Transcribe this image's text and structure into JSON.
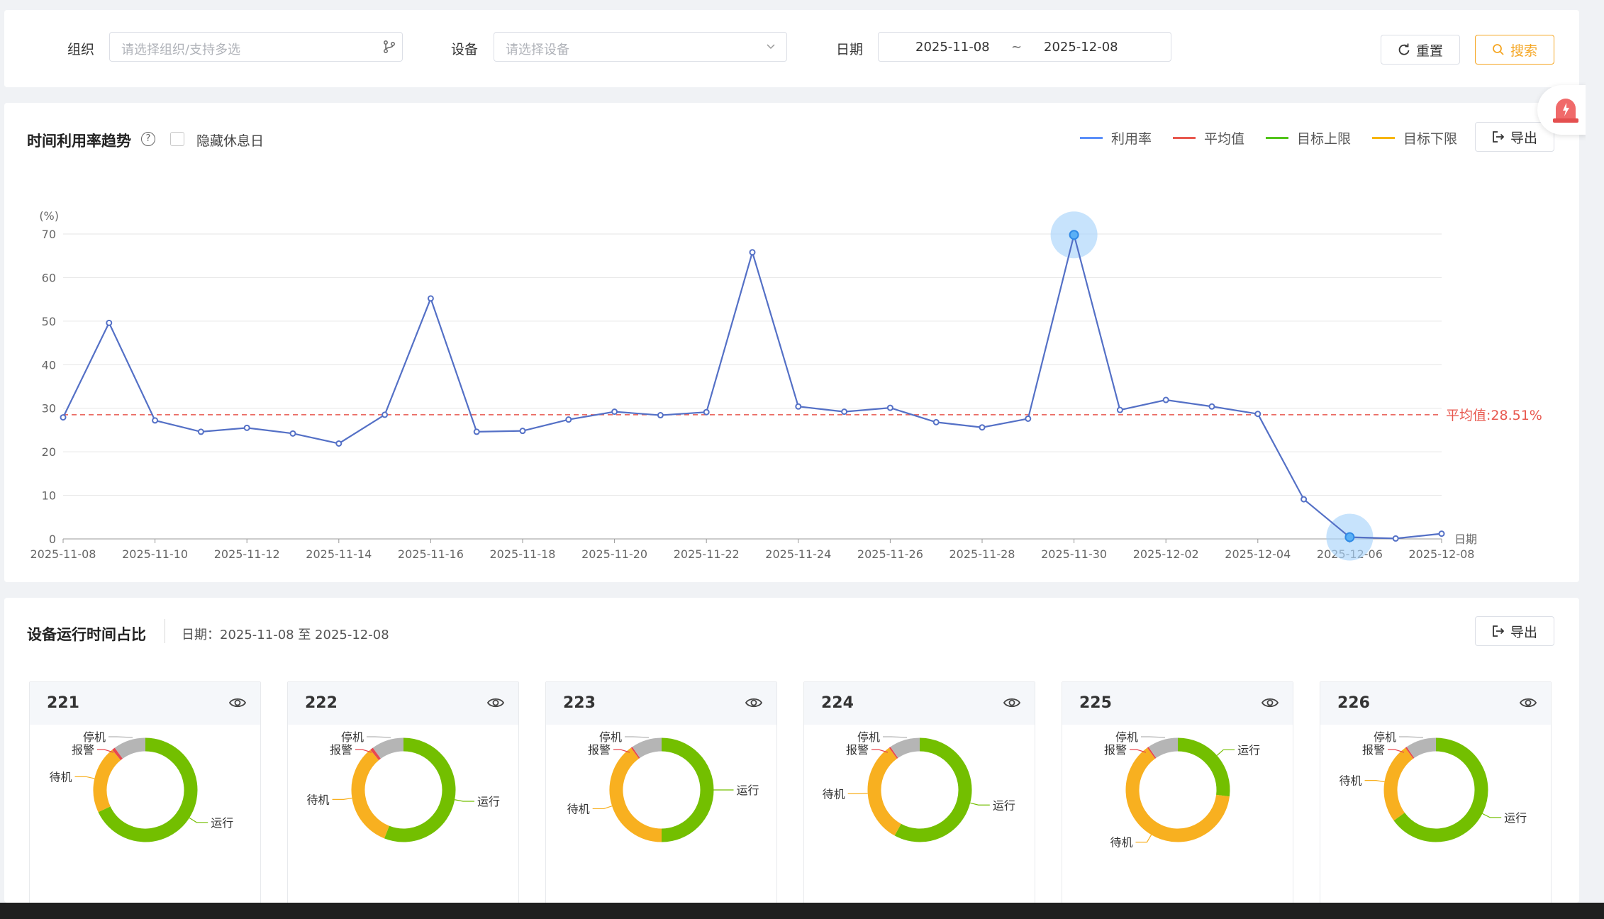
{
  "filters": {
    "org_label": "组织",
    "org_placeholder": "请选择组织/支持多选",
    "device_label": "设备",
    "device_placeholder": "请选择设备",
    "date_label": "日期",
    "date_start": "2025-11-08",
    "date_sep": "~",
    "date_end": "2025-12-08",
    "reset_label": "重置",
    "search_label": "搜索"
  },
  "trend": {
    "title": "时间利用率趋势",
    "hide_holiday_label": "隐藏休息日",
    "export_label": "导出",
    "legend": [
      {
        "name": "利用率",
        "color": "#5b8ff9"
      },
      {
        "name": "平均值",
        "color": "#e8584f"
      },
      {
        "name": "目标上限",
        "color": "#52c41a"
      },
      {
        "name": "目标下限",
        "color": "#f7b500"
      }
    ],
    "avg_label": "平均值:28.51%"
  },
  "chart_data": {
    "type": "line",
    "title": "时间利用率趋势",
    "ylabel": "(%)",
    "xlabel": "日期",
    "ylim": [
      0,
      70
    ],
    "yticks": [
      0,
      10,
      20,
      30,
      40,
      50,
      60,
      70
    ],
    "x": [
      "2025-11-08",
      "2025-11-09",
      "2025-11-10",
      "2025-11-11",
      "2025-11-12",
      "2025-11-13",
      "2025-11-14",
      "2025-11-15",
      "2025-11-16",
      "2025-11-17",
      "2025-11-18",
      "2025-11-19",
      "2025-11-20",
      "2025-11-21",
      "2025-11-22",
      "2025-11-23",
      "2025-11-24",
      "2025-11-25",
      "2025-11-26",
      "2025-11-27",
      "2025-11-28",
      "2025-11-29",
      "2025-11-30",
      "2025-12-01",
      "2025-12-02",
      "2025-12-03",
      "2025-12-04",
      "2025-12-05",
      "2025-12-06",
      "2025-12-07",
      "2025-12-08"
    ],
    "xticks": [
      "2025-11-08",
      "2025-11-10",
      "2025-11-12",
      "2025-11-14",
      "2025-11-16",
      "2025-11-18",
      "2025-11-20",
      "2025-11-22",
      "2025-11-24",
      "2025-11-26",
      "2025-11-28",
      "2025-11-30",
      "2025-12-02",
      "2025-12-04",
      "2025-12-06",
      "2025-12-08"
    ],
    "series": [
      {
        "name": "利用率",
        "color": "#5470c6",
        "values": [
          27.9,
          49.6,
          27.2,
          24.6,
          25.5,
          24.2,
          21.9,
          28.5,
          55.2,
          24.6,
          24.8,
          27.4,
          29.2,
          28.4,
          29.1,
          65.8,
          30.4,
          29.2,
          30.1,
          26.8,
          25.6,
          27.6,
          69.8,
          29.6,
          31.9,
          30.4,
          28.7,
          9.1,
          0.4,
          0.1,
          1.2
        ]
      }
    ],
    "average": 28.51,
    "highlighted": [
      "2025-11-30",
      "2025-12-06"
    ],
    "grid": true,
    "legend_position": "top-right"
  },
  "ratio": {
    "title": "设备运行时间占比",
    "date_text": "日期：2025-11-08 至 2025-12-08",
    "export_label": "导出",
    "status_colors": {
      "运行": "#73bf00",
      "待机": "#f8b020",
      "报警": "#e8484f",
      "停机": "#b5b5b5"
    },
    "devices": [
      {
        "name": "221",
        "segments": [
          {
            "label": "运行",
            "value": 68
          },
          {
            "label": "待机",
            "value": 21
          },
          {
            "label": "报警",
            "value": 1
          },
          {
            "label": "停机",
            "value": 10
          }
        ]
      },
      {
        "name": "222",
        "segments": [
          {
            "label": "运行",
            "value": 56
          },
          {
            "label": "待机",
            "value": 33
          },
          {
            "label": "报警",
            "value": 1
          },
          {
            "label": "停机",
            "value": 10
          }
        ]
      },
      {
        "name": "223",
        "segments": [
          {
            "label": "运行",
            "value": 50
          },
          {
            "label": "待机",
            "value": 40
          },
          {
            "label": "报警",
            "value": 0.5
          },
          {
            "label": "停机",
            "value": 9.5
          }
        ]
      },
      {
        "name": "224",
        "segments": [
          {
            "label": "运行",
            "value": 58
          },
          {
            "label": "待机",
            "value": 32
          },
          {
            "label": "报警",
            "value": 0.5
          },
          {
            "label": "停机",
            "value": 9.5
          }
        ]
      },
      {
        "name": "225",
        "segments": [
          {
            "label": "运行",
            "value": 27
          },
          {
            "label": "待机",
            "value": 63
          },
          {
            "label": "报警",
            "value": 0.5
          },
          {
            "label": "停机",
            "value": 9.5
          }
        ]
      },
      {
        "name": "226",
        "segments": [
          {
            "label": "运行",
            "value": 65
          },
          {
            "label": "待机",
            "value": 25
          },
          {
            "label": "报警",
            "value": 0.5
          },
          {
            "label": "停机",
            "value": 9.5
          }
        ]
      }
    ]
  }
}
